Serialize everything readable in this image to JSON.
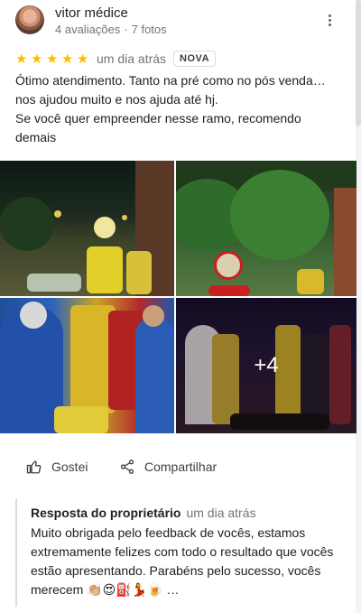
{
  "review": {
    "author": "vitor médice",
    "reviews_count": "4 avaliações",
    "photos_count": "7 fotos",
    "rating": 5,
    "rating_max": 5,
    "time": "um dia atrás",
    "badge": "NOVA",
    "text_lines": [
      "Ótimo atendimento. Tanto na pré como no pós venda…",
      "nos ajudou muito e nos ajuda até hj.",
      "Se você quer empreender nesse ramo, recomendo",
      "demais"
    ],
    "more_photos": "+4"
  },
  "actions": {
    "like": "Gostei",
    "share": "Compartilhar"
  },
  "owner_reply": {
    "title": "Resposta do proprietário",
    "time": "um dia atrás",
    "text": "Muito obrigada pelo feedback de vocês, estamos extremamente felizes com todo o resultado que vocês estão apresentando. Parabéns pelo sucesso, vocês merecem 👏🏼😍⛽💃🍺 …"
  },
  "colors": {
    "star": "#fbbc04",
    "secondary_text": "#70757a"
  },
  "icons": {
    "more": "more-vert-icon",
    "like": "thumb-up-icon",
    "share": "share-icon",
    "star": "star-icon"
  }
}
